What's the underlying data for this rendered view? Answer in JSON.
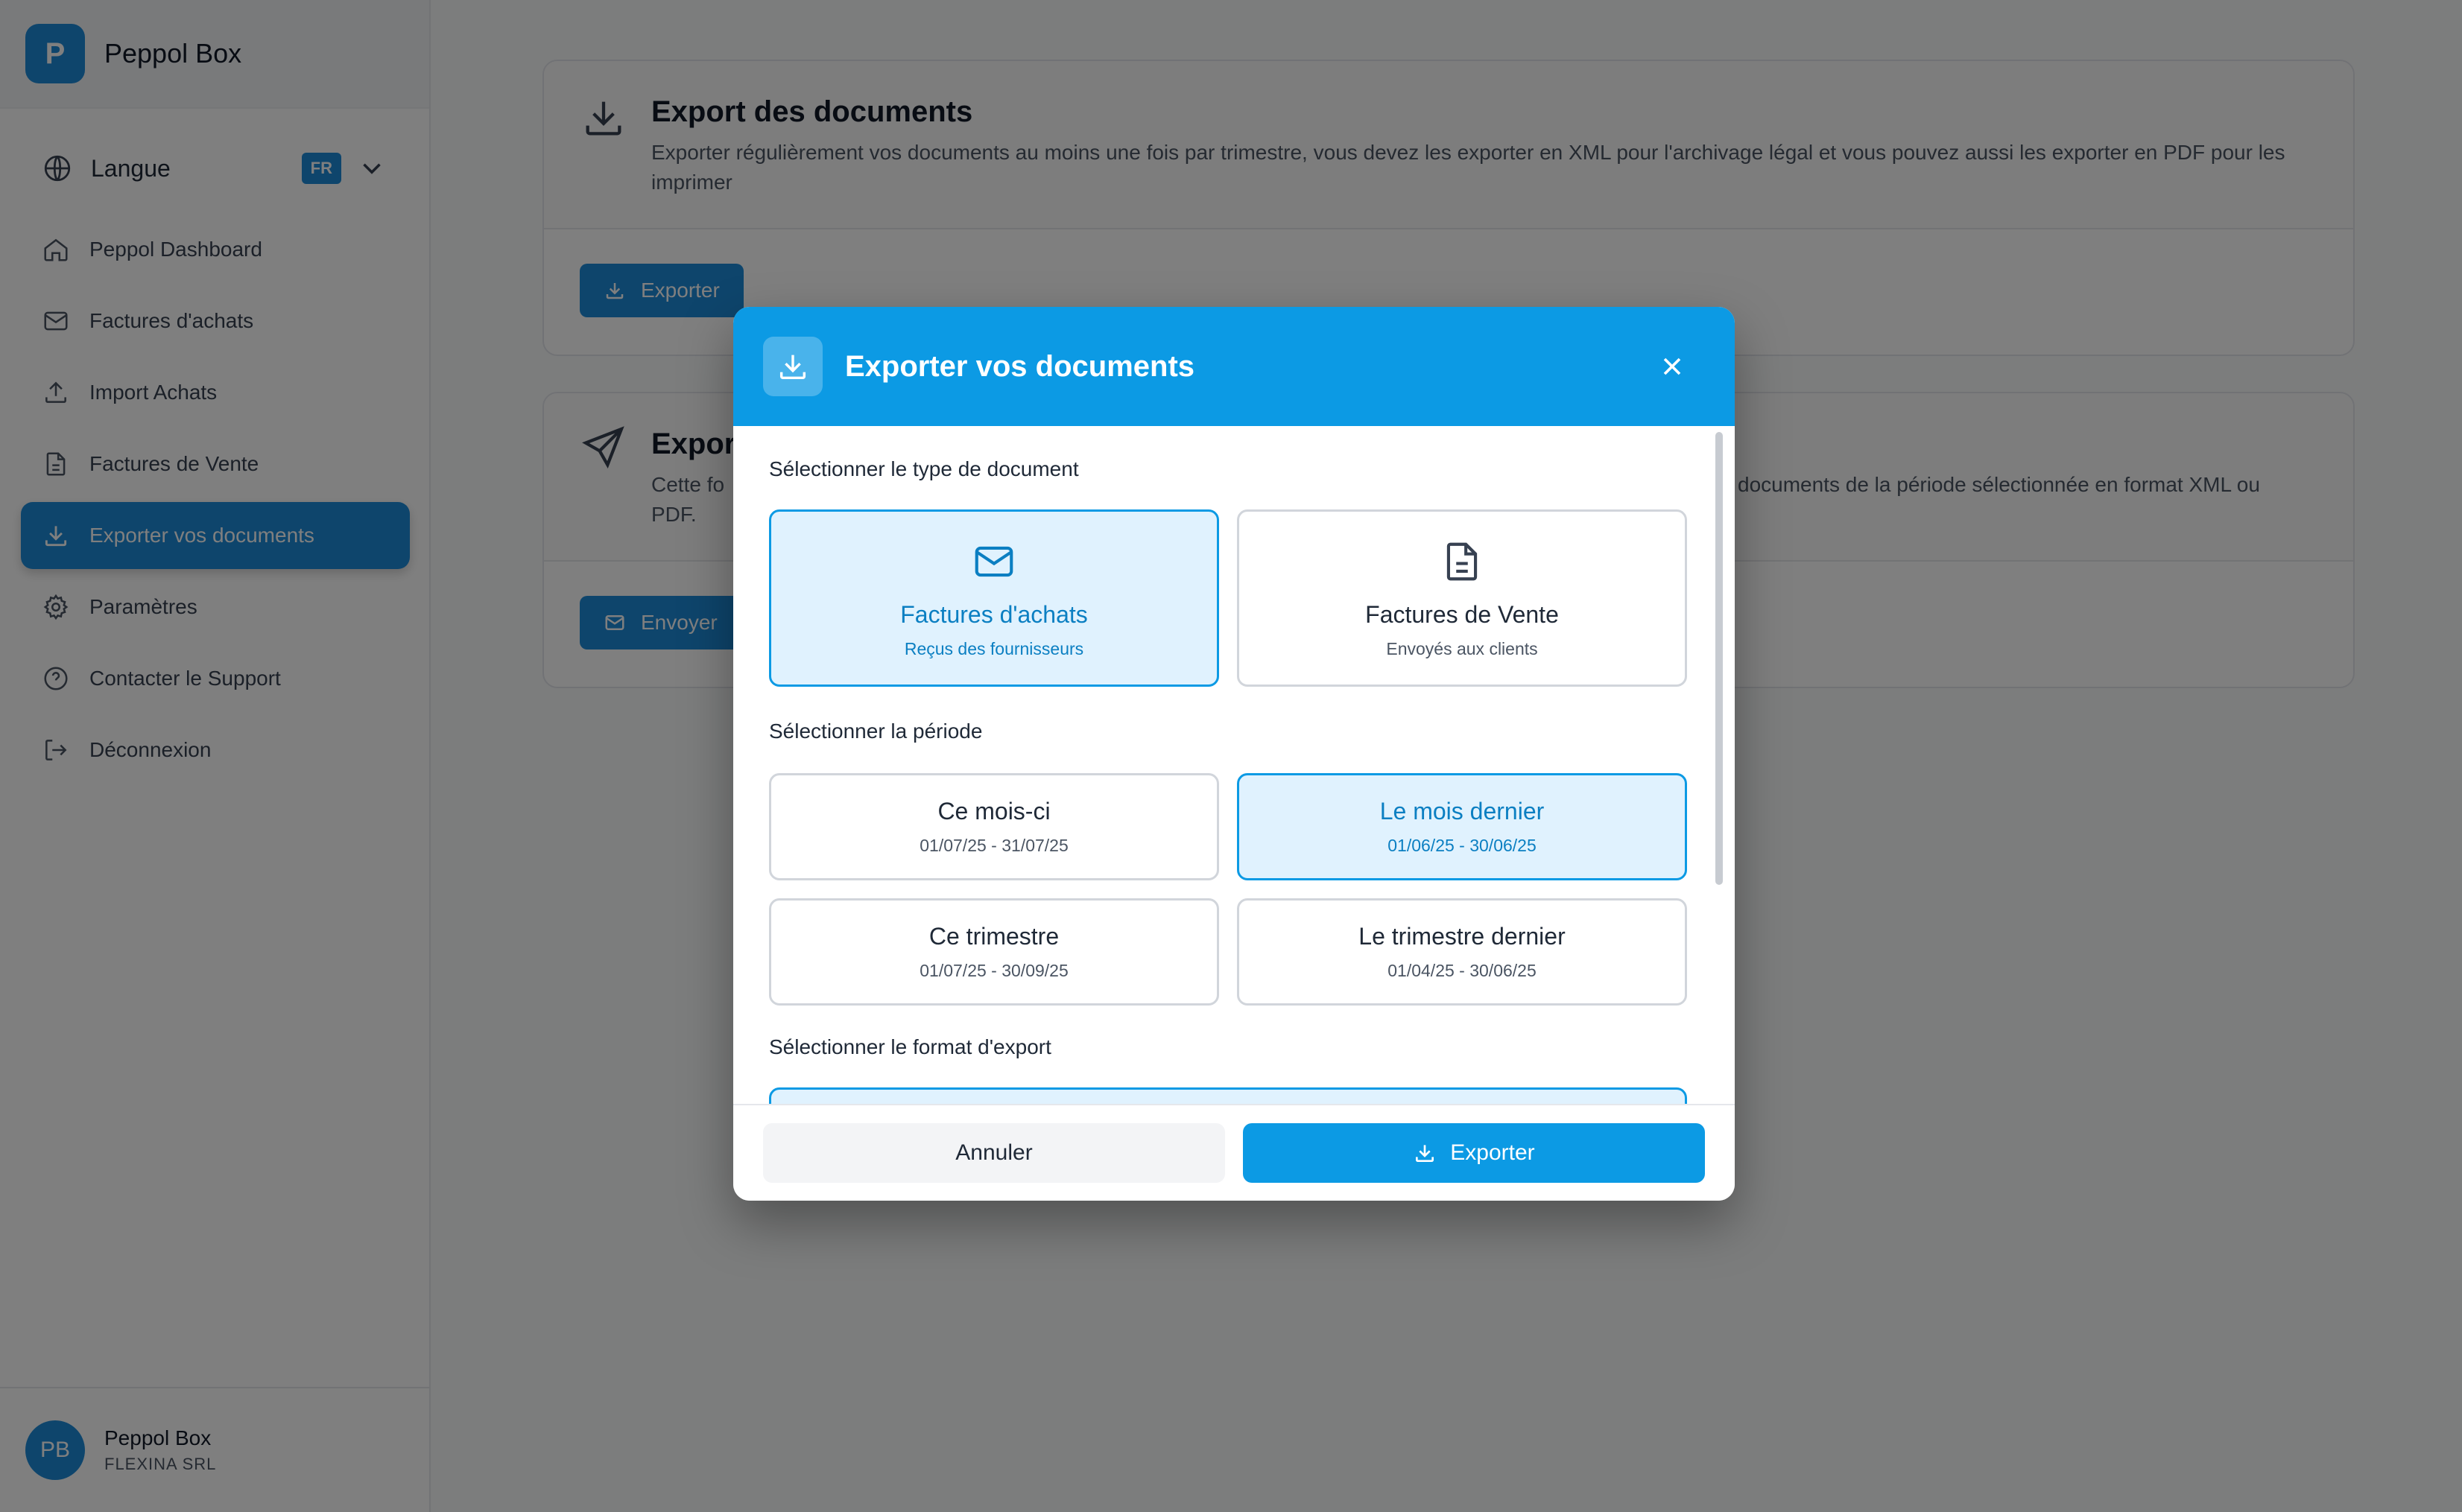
{
  "app": {
    "logo_letter": "P",
    "name": "Peppol Box"
  },
  "sidebar": {
    "language": {
      "label": "Langue",
      "badge": "FR"
    },
    "items": [
      {
        "label": "Peppol Dashboard",
        "icon": "home-icon"
      },
      {
        "label": "Factures d'achats",
        "icon": "mail-icon"
      },
      {
        "label": "Import Achats",
        "icon": "upload-icon"
      },
      {
        "label": "Factures de Vente",
        "icon": "document-icon"
      },
      {
        "label": "Exporter vos documents",
        "icon": "download-icon",
        "active": true
      },
      {
        "label": "Paramètres",
        "icon": "gear-icon"
      },
      {
        "label": "Contacter le Support",
        "icon": "help-icon"
      },
      {
        "label": "Déconnexion",
        "icon": "logout-icon"
      }
    ],
    "user": {
      "initials": "PB",
      "name": "Peppol Box",
      "org": "FLEXINA SRL"
    }
  },
  "main": {
    "card1": {
      "title": "Export des documents",
      "description": "Exporter régulièrement vos documents au moins une fois par trimestre, vous devez les exporter en XML pour l'archivage légal et vous pouvez aussi les exporter en PDF pour les imprimer",
      "button": "Exporter"
    },
    "card2": {
      "title": "Expor",
      "description_left": "Cette fo",
      "description_left_2": "PDF.",
      "description_right": "documents de la période sélectionnée en format XML ou",
      "button": "Envoyer"
    }
  },
  "modal": {
    "title": "Exporter vos documents",
    "doc_type_label": "Sélectionner le type de document",
    "doc_types": [
      {
        "title": "Factures d'achats",
        "subtitle": "Reçus des fournisseurs",
        "icon": "mail-icon",
        "selected": true
      },
      {
        "title": "Factures de Vente",
        "subtitle": "Envoyés aux clients",
        "icon": "document-icon",
        "selected": false
      }
    ],
    "period_label": "Sélectionner la période",
    "periods": [
      {
        "title": "Ce mois-ci",
        "range": "01/07/25 - 31/07/25",
        "selected": false
      },
      {
        "title": "Le mois dernier",
        "range": "01/06/25 - 30/06/25",
        "selected": true
      },
      {
        "title": "Ce trimestre",
        "range": "01/07/25 - 30/09/25",
        "selected": false
      },
      {
        "title": "Le trimestre dernier",
        "range": "01/04/25 - 30/06/25",
        "selected": false
      }
    ],
    "format_label": "Sélectionner le format d'export",
    "cancel": "Annuler",
    "export": "Exporter"
  },
  "colors": {
    "brand": "#1d8ad8",
    "modal_header": "#0c9ae4",
    "selected_bg": "#e0f2fe"
  }
}
